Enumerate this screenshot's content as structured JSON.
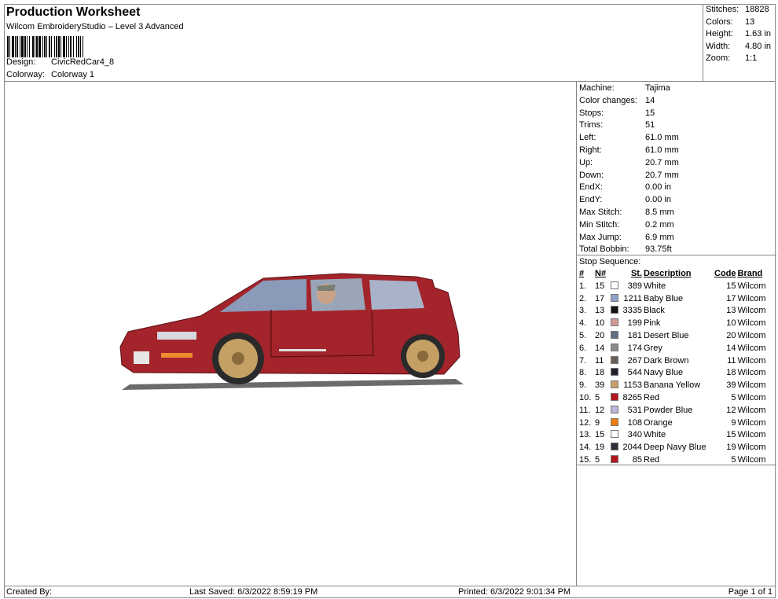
{
  "header": {
    "title": "Production Worksheet",
    "subtitle": "Wilcom EmbroideryStudio – Level 3 Advanced",
    "design_label": "Design:",
    "design": "CivicRedCar4_8",
    "colorway_label": "Colorway:",
    "colorway": "Colorway 1"
  },
  "stats": [
    {
      "k": "Stitches:",
      "v": "18828"
    },
    {
      "k": "Colors:",
      "v": "13"
    },
    {
      "k": "Height:",
      "v": "1.63 in"
    },
    {
      "k": "Width:",
      "v": "4.80 in"
    },
    {
      "k": "Zoom:",
      "v": "1:1"
    }
  ],
  "machine": [
    {
      "k": "Machine:",
      "v": "Tajima"
    },
    {
      "k": "Color changes:",
      "v": "14"
    },
    {
      "k": "Stops:",
      "v": "15"
    },
    {
      "k": "Trims:",
      "v": "51"
    },
    {
      "k": "Left:",
      "v": "61.0 mm"
    },
    {
      "k": "Right:",
      "v": "61.0 mm"
    },
    {
      "k": "Up:",
      "v": "20.7 mm"
    },
    {
      "k": "Down:",
      "v": "20.7 mm"
    },
    {
      "k": "EndX:",
      "v": "0.00 in"
    },
    {
      "k": "EndY:",
      "v": "0.00 in"
    },
    {
      "k": "Max Stitch:",
      "v": "8.5 mm"
    },
    {
      "k": "Min Stitch:",
      "v": "0.2 mm"
    },
    {
      "k": "Max Jump:",
      "v": "6.9 mm"
    },
    {
      "k": "Total Bobbin:",
      "v": "93.75ft"
    }
  ],
  "stop_sequence_label": "Stop Sequence:",
  "columns": {
    "num": "#",
    "n": "N#",
    "st": "St.",
    "desc": "Description",
    "code": "Code",
    "brand": "Brand"
  },
  "stops": [
    {
      "num": "1.",
      "n": "15",
      "color": "#ffffff",
      "st": "389",
      "desc": "White",
      "code": "15",
      "brand": "Wilcom"
    },
    {
      "num": "2.",
      "n": "17",
      "color": "#8fa3c8",
      "st": "1211",
      "desc": "Baby Blue",
      "code": "17",
      "brand": "Wilcom"
    },
    {
      "num": "3.",
      "n": "13",
      "color": "#151515",
      "st": "3335",
      "desc": "Black",
      "code": "13",
      "brand": "Wilcom"
    },
    {
      "num": "4.",
      "n": "10",
      "color": "#d49a94",
      "st": "199",
      "desc": "Pink",
      "code": "10",
      "brand": "Wilcom"
    },
    {
      "num": "5.",
      "n": "20",
      "color": "#5f6f82",
      "st": "181",
      "desc": "Desert Blue",
      "code": "20",
      "brand": "Wilcom"
    },
    {
      "num": "6.",
      "n": "14",
      "color": "#8a8a8a",
      "st": "174",
      "desc": "Grey",
      "code": "14",
      "brand": "Wilcom"
    },
    {
      "num": "7.",
      "n": "11",
      "color": "#6a5f58",
      "st": "267",
      "desc": "Dark Brown",
      "code": "11",
      "brand": "Wilcom"
    },
    {
      "num": "8.",
      "n": "18",
      "color": "#20222e",
      "st": "544",
      "desc": "Navy Blue",
      "code": "18",
      "brand": "Wilcom"
    },
    {
      "num": "9.",
      "n": "39",
      "color": "#c9a06a",
      "st": "1153",
      "desc": "Banana Yellow",
      "code": "39",
      "brand": "Wilcom"
    },
    {
      "num": "10.",
      "n": "5",
      "color": "#b3161c",
      "st": "8265",
      "desc": "Red",
      "code": "5",
      "brand": "Wilcom"
    },
    {
      "num": "11.",
      "n": "12",
      "color": "#b8b8dc",
      "st": "531",
      "desc": "Powder Blue",
      "code": "12",
      "brand": "Wilcom"
    },
    {
      "num": "12.",
      "n": "9",
      "color": "#ee7d10",
      "st": "108",
      "desc": "Orange",
      "code": "9",
      "brand": "Wilcom"
    },
    {
      "num": "13.",
      "n": "15",
      "color": "#ffffff",
      "st": "340",
      "desc": "White",
      "code": "15",
      "brand": "Wilcom"
    },
    {
      "num": "14.",
      "n": "19",
      "color": "#2c2f38",
      "st": "2044",
      "desc": "Deep Navy Blue",
      "code": "19",
      "brand": "Wilcom"
    },
    {
      "num": "15.",
      "n": "5",
      "color": "#b3161c",
      "st": "85",
      "desc": "Red",
      "code": "5",
      "brand": "Wilcom"
    }
  ],
  "footer": {
    "created": "Created By:",
    "saved": "Last Saved: 6/3/2022 8:59:19 PM",
    "printed": "Printed: 6/3/2022 9:01:34 PM",
    "page": "Page 1 of 1"
  }
}
